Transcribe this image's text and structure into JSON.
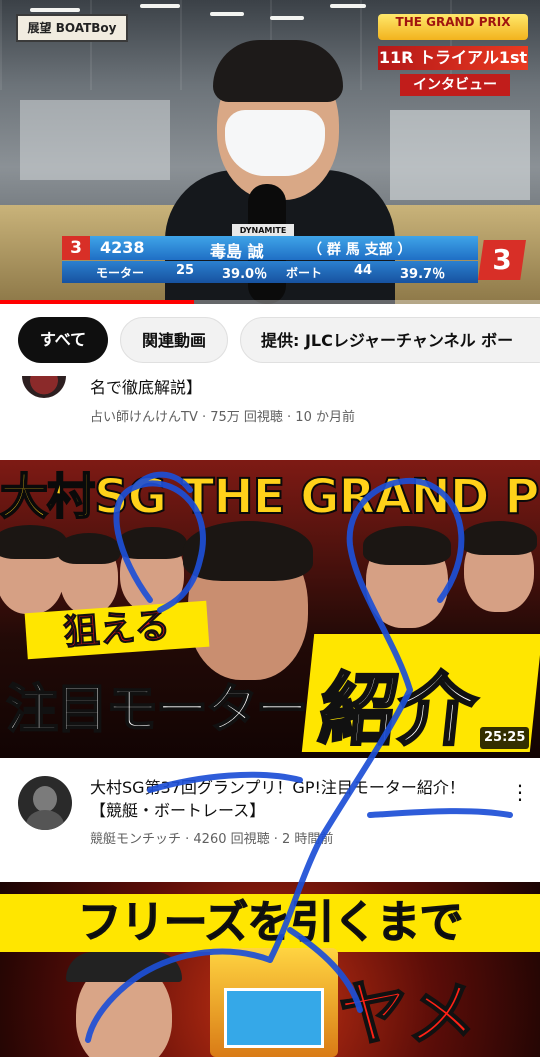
{
  "player": {
    "watermark": "展望 BOATBoy",
    "badge_title": "THE GRAND PRIX",
    "badge_sub": "",
    "caption_line1": "11R トライアル1st",
    "caption_line2": "インタビュー",
    "mic_flag": "DYNAMITE",
    "racer": {
      "lane": "3",
      "registration": "4238",
      "name": "毒島 誠",
      "branch": "（ 群 馬 支部 ）",
      "motor_label": "モーター",
      "motor_no": "25",
      "motor_rate": "39.0％",
      "boat_label": "ボート",
      "boat_no": "44",
      "boat_rate": "39.7％",
      "lane_right": "3"
    },
    "progress_fraction": 0.36
  },
  "chips": [
    {
      "label": "すべて",
      "active": true
    },
    {
      "label": "関連動画",
      "active": false
    },
    {
      "label": "提供: JLCレジャーチャンネル ボー",
      "active": false
    }
  ],
  "partial_item": {
    "title_tail": "名で徹底解説】",
    "meta": "占い師けんけんTV · 75万 回視聴 · 10 か月前"
  },
  "video1": {
    "thumb_title": "大村SG THE GRAND PRIX",
    "thumb_tag": "狙える",
    "thumb_big_left": "注目モーター",
    "thumb_big_right": "紹介",
    "duration": "25:25",
    "title": "大村SG第37回グランプリ！GP!注目モーター紹介！【競艇・ボートレース】",
    "meta": "競艇モンチッチ · 4260 回視聴 · 2 時間前",
    "more_icon": "vertical-ellipsis"
  },
  "video2": {
    "thumb_title": "フリーズを引くまで",
    "thumb_red": "ヤメ"
  },
  "colors": {
    "chip_active_bg": "#0f0f0f",
    "progress": "#ff0000",
    "scribble": "#1d4fd6"
  }
}
